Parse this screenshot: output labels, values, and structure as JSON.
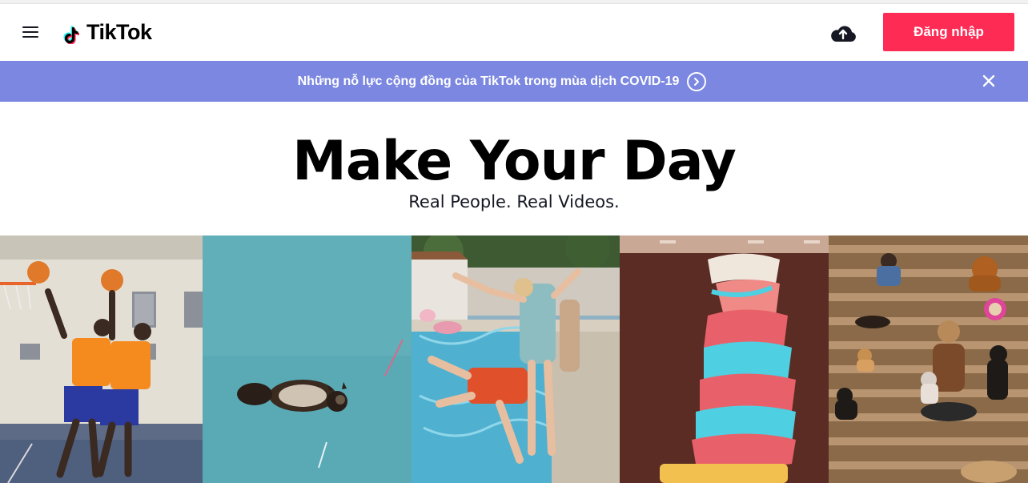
{
  "header": {
    "brand": "TikTok",
    "login_label": "Đăng nhập"
  },
  "banner": {
    "text": "Những nỗ lực cộng đồng của TikTok trong mùa dịch COVID-19"
  },
  "hero": {
    "title": "Make Your Day",
    "subtitle": "Real People. Real Videos."
  },
  "colors": {
    "accent": "#fe2c55",
    "banner_bg": "#7b87e0",
    "logo_cyan": "#25f4ee",
    "logo_red": "#fe2c55"
  },
  "icons": [
    "hamburger-menu-icon",
    "tiktok-note-icon",
    "cloud-upload-icon",
    "chevron-right-circle-icon",
    "close-icon"
  ],
  "videos": [
    {
      "subject": "basketball-players"
    },
    {
      "subject": "cat-in-pool"
    },
    {
      "subject": "pool-jump"
    },
    {
      "subject": "ice-cream-cone"
    },
    {
      "subject": "dogs-on-bleachers"
    }
  ]
}
